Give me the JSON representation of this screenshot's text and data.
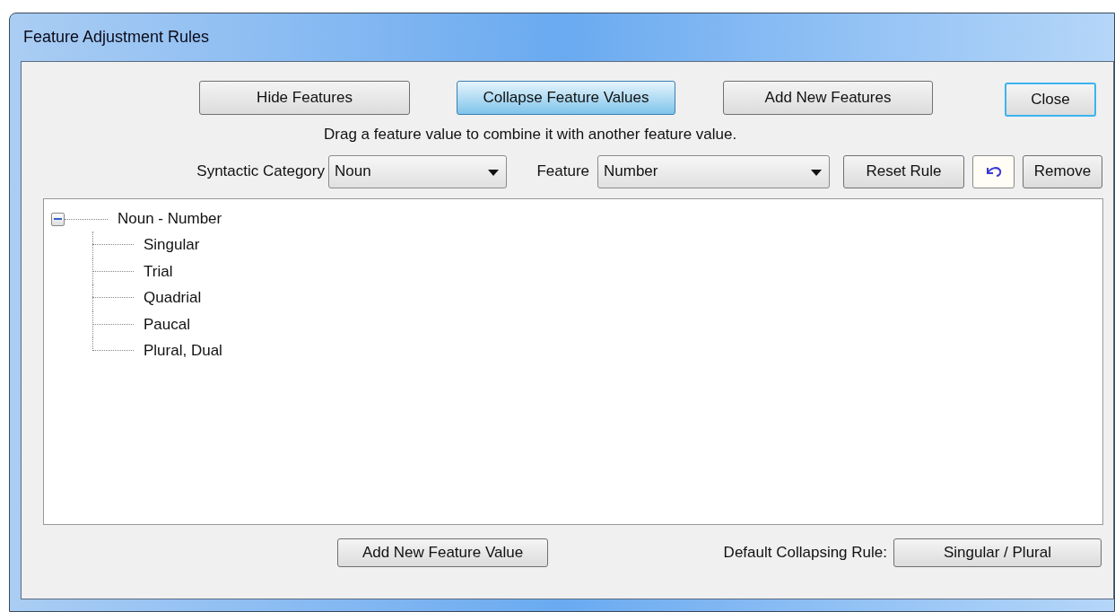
{
  "window": {
    "title": "Feature Adjustment Rules"
  },
  "mode_buttons": [
    {
      "label": "Hide Features",
      "selected": false
    },
    {
      "label": "Collapse Feature Values",
      "selected": true
    },
    {
      "label": "Add New Features",
      "selected": false
    }
  ],
  "close_button": {
    "label": "Close",
    "focused": true
  },
  "instruction": "Drag a feature value to combine it with another feature value.",
  "syntactic_category": {
    "label": "Syntactic Category",
    "value": "Noun"
  },
  "feature": {
    "label": "Feature",
    "value": "Number"
  },
  "reset_button": "Reset Rule",
  "remove_button": "Remove",
  "tree": {
    "label": "Noun - Number",
    "expanded": true,
    "children": [
      {
        "label": "Singular"
      },
      {
        "label": "Trial"
      },
      {
        "label": "Quadrial"
      },
      {
        "label": "Paucal"
      },
      {
        "label": "Plural, Dual"
      }
    ]
  },
  "add_value_button": "Add New Feature Value",
  "default_rule": {
    "label": "Default Collapsing Rule:",
    "value": "Singular / Plural"
  }
}
